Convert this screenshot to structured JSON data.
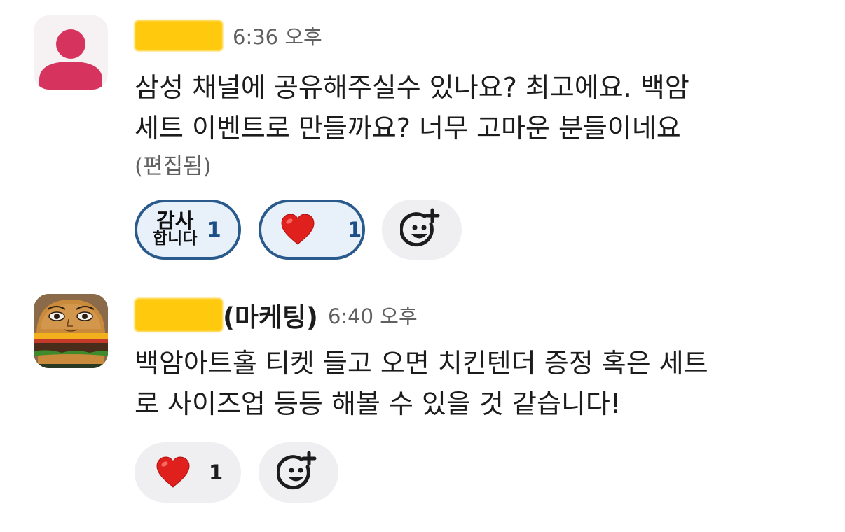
{
  "messages": [
    {
      "sender_suffix": "",
      "time": "6:36 오후",
      "text_line1": "삼성 채널에 공유해주실수 있나요? 최고에요. 백암",
      "text_line2": "세트 이벤트로 만들까요? 너무 고마운 분들이네요",
      "edited_label": "(편집됨)",
      "reactions": [
        {
          "emoji_line1": "감사",
          "emoji_line2": "합니다",
          "count": "1",
          "active": true
        },
        {
          "emoji": "heart",
          "count": "1",
          "active": true
        }
      ]
    },
    {
      "sender_suffix": "(마케팅)",
      "time": "6:40 오후",
      "text_line1": "백암아트홀 티켓 들고 오면 치킨텐더 증정 혹은 세트",
      "text_line2": "로 사이즈업 등등 해볼 수 있을 것 같습니다!",
      "reactions": [
        {
          "emoji": "heart",
          "count": "1",
          "active": false
        }
      ]
    }
  ],
  "colors": {
    "active_reaction_bg": "#e8f1fa",
    "active_reaction_border": "#2a5a8c",
    "inactive_reaction_bg": "#efeef0",
    "redaction": "#ffc90e",
    "default_avatar": "#d6335f"
  },
  "icons": {
    "default_avatar": "person-icon",
    "heart": "heart-icon",
    "add_reaction": "add-reaction-icon"
  }
}
